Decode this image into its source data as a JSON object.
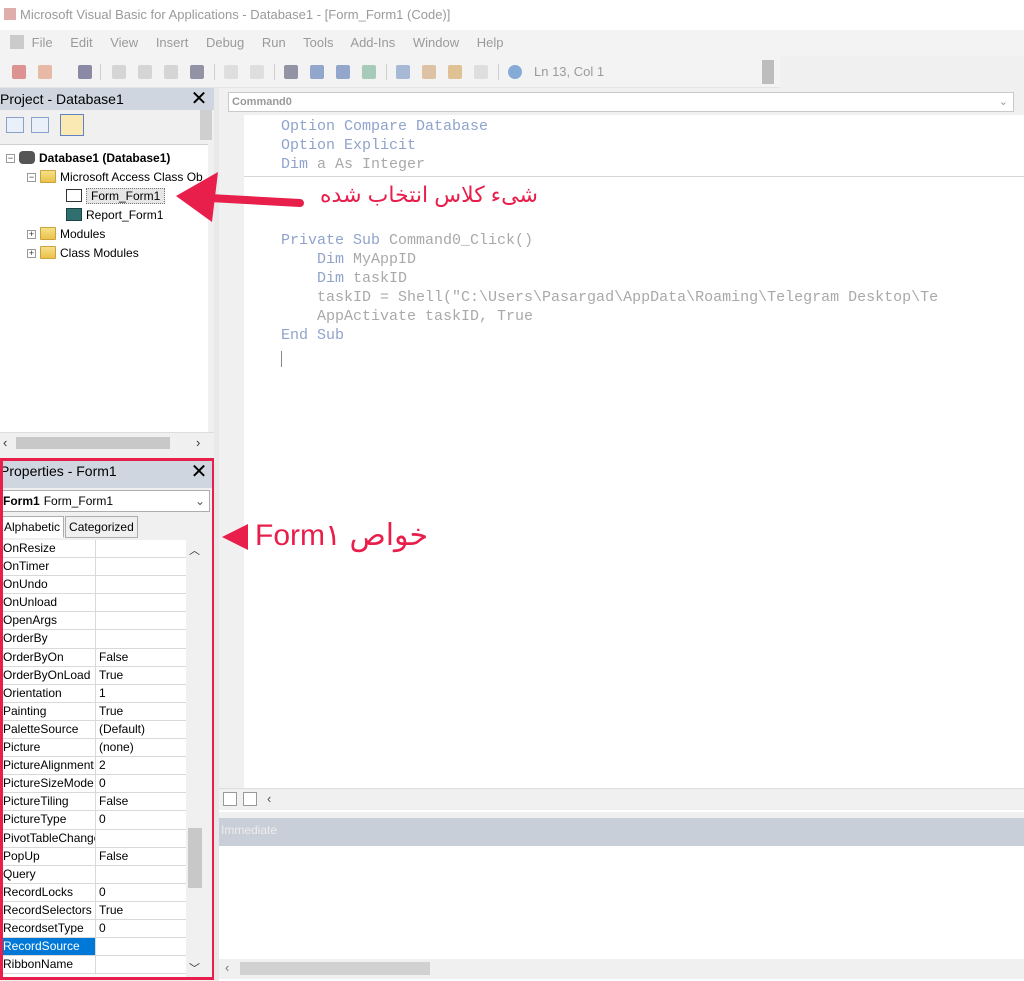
{
  "window": {
    "title": "Microsoft Visual Basic for Applications - Database1 - [Form_Form1 (Code)]"
  },
  "menu": [
    "File",
    "Edit",
    "View",
    "Insert",
    "Debug",
    "Run",
    "Tools",
    "Add-Ins",
    "Window",
    "Help"
  ],
  "toolbar": {
    "cursor_position": "Ln 13, Col 1"
  },
  "project": {
    "title": "Project - Database1",
    "close": "✕",
    "tree": {
      "root": "Database1 (Database1)",
      "class_objects": "Microsoft Access Class Ob",
      "form": "Form_Form1",
      "report": "Report_Form1",
      "modules": "Modules",
      "class_modules": "Class Modules"
    }
  },
  "properties": {
    "title": "Properties - Form1",
    "close": "✕",
    "object_name": "Form1",
    "object_type": "Form_Form1",
    "tab_alphabetic": "Alphabetic",
    "tab_categorized": "Categorized",
    "rows": [
      {
        "name": "OnResize",
        "value": ""
      },
      {
        "name": "OnTimer",
        "value": ""
      },
      {
        "name": "OnUndo",
        "value": ""
      },
      {
        "name": "OnUnload",
        "value": ""
      },
      {
        "name": "OpenArgs",
        "value": ""
      },
      {
        "name": "OrderBy",
        "value": ""
      },
      {
        "name": "OrderByOn",
        "value": "False"
      },
      {
        "name": "OrderByOnLoad",
        "value": "True"
      },
      {
        "name": "Orientation",
        "value": "1"
      },
      {
        "name": "Painting",
        "value": "True"
      },
      {
        "name": "PaletteSource",
        "value": "(Default)"
      },
      {
        "name": "Picture",
        "value": "(none)"
      },
      {
        "name": "PictureAlignment",
        "value": "2"
      },
      {
        "name": "PictureSizeMode",
        "value": "0"
      },
      {
        "name": "PictureTiling",
        "value": "False"
      },
      {
        "name": "PictureType",
        "value": "0"
      },
      {
        "name": "PivotTableChange",
        "value": ""
      },
      {
        "name": "PopUp",
        "value": "False"
      },
      {
        "name": "Query",
        "value": ""
      },
      {
        "name": "RecordLocks",
        "value": "0"
      },
      {
        "name": "RecordSelectors",
        "value": "True"
      },
      {
        "name": "RecordsetType",
        "value": "0"
      },
      {
        "name": "RecordSource",
        "value": ""
      },
      {
        "name": "RibbonName",
        "value": ""
      }
    ],
    "selected_row": "RecordSource"
  },
  "code": {
    "object_combo": "Command0",
    "lines": [
      {
        "indent": "",
        "kw": "Option Compare Database",
        "rest": ""
      },
      {
        "indent": "",
        "kw": "Option Explicit",
        "rest": ""
      },
      {
        "indent": "",
        "kw": "Dim",
        "rest": " a As Integer"
      },
      {
        "indent": "",
        "kw": "Private Sub",
        "rest": " Command0_Click()"
      },
      {
        "indent": "    ",
        "kw": "Dim",
        "rest": " MyAppID"
      },
      {
        "indent": "    ",
        "kw": "Dim",
        "rest": " taskID"
      },
      {
        "indent": "    ",
        "kw": "",
        "rest": "taskID = Shell(\"C:\\Users\\Pasargad\\AppData\\Roaming\\Telegram Desktop\\Te"
      },
      {
        "indent": "    ",
        "kw": "",
        "rest": "AppActivate taskID, True"
      },
      {
        "indent": "",
        "kw": "End Sub",
        "rest": ""
      }
    ]
  },
  "immediate": {
    "title": "Immediate"
  },
  "annotations": {
    "class_object": "شیء کلاس انتخاب شده",
    "form_props": "خواص Form۱"
  },
  "colors": {
    "annotation": "#e81e4b",
    "selection": "#0078d7"
  }
}
